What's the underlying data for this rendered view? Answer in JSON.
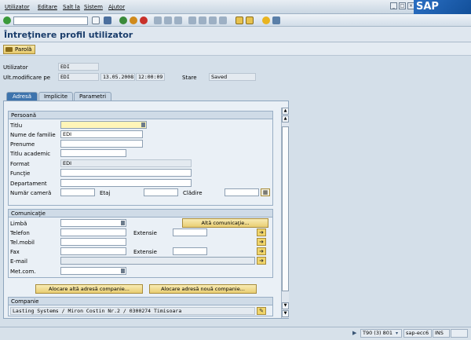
{
  "menu": {
    "items": [
      "Utilizator",
      "Editare",
      "Salt la",
      "Sistem",
      "Ajutor"
    ],
    "logo": "SAP"
  },
  "toolbar": {
    "command_value": "",
    "icons": [
      "enter-icon",
      "save-icon",
      "back-icon",
      "exit-icon",
      "cancel-icon",
      "print-icon",
      "find-icon",
      "find-next-icon",
      "first-page-icon",
      "prev-page-icon",
      "next-page-icon",
      "last-page-icon",
      "new-session-icon",
      "shortcut-icon",
      "help-icon",
      "customize-icon"
    ]
  },
  "title": "Întreţinere profil utilizator",
  "app_toolbar": {
    "parola_label": "Parolă"
  },
  "header": {
    "utilizator_label": "Utilizator",
    "utilizator_value": "EDI",
    "ult_mod_label": "Ult.modificare pe",
    "ult_mod_user": "EDI",
    "ult_mod_date": "13.05.2008",
    "ult_mod_time": "12:00:09",
    "stare_label": "Stare",
    "stare_value": "Saved"
  },
  "tabs": [
    {
      "label": "Adresă",
      "active": true
    },
    {
      "label": "Implicite",
      "active": false
    },
    {
      "label": "Parametri",
      "active": false
    }
  ],
  "persoana": {
    "title": "Persoană",
    "titlu_label": "Titlu",
    "titlu_value": "",
    "nume_label": "Nume de familie",
    "nume_value": "EDI",
    "prenume_label": "Prenume",
    "prenume_value": "",
    "titlu_acad_label": "Titlu academic",
    "titlu_acad_value": "",
    "format_label": "Format",
    "format_value": "EDI",
    "functie_label": "Funcţie",
    "functie_value": "",
    "departament_label": "Departament",
    "departament_value": "",
    "camera_label": "Număr cameră",
    "camera_value": "",
    "etaj_label": "Etaj",
    "etaj_value": "",
    "cladire_label": "Clădire",
    "cladire_value": ""
  },
  "comunicatie": {
    "title": "Comunicaţie",
    "limba_label": "Limbă",
    "limba_value": "",
    "alta_btn": "Altă comunicaţie...",
    "telefon_label": "Telefon",
    "telefon_value": "",
    "extensie_label": "Extensie",
    "extensie1_value": "",
    "telmobil_label": "Tel.mobil",
    "telmobil_value": "",
    "fax_label": "Fax",
    "fax_value": "",
    "extensie2_value": "",
    "email_label": "E-mail",
    "email_value": "",
    "metcom_label": "Met.com.",
    "metcom_value": ""
  },
  "buttons": {
    "alocare_alta": "Alocare altă adresă companie...",
    "alocare_noua": "Alocare adresă nouă companie..."
  },
  "companie": {
    "title": "Companie",
    "value": "Lasting Systems / Miron Costin Nr.2 / 0300274 Timisoara"
  },
  "status": {
    "system": "T90 (3) 801",
    "server": "sap-ecc6",
    "mode": "INS"
  },
  "colors": {
    "accent": "#3e74ad",
    "title": "#1a3d6b",
    "button": "#e9cd72",
    "required": "#fff5b8"
  }
}
